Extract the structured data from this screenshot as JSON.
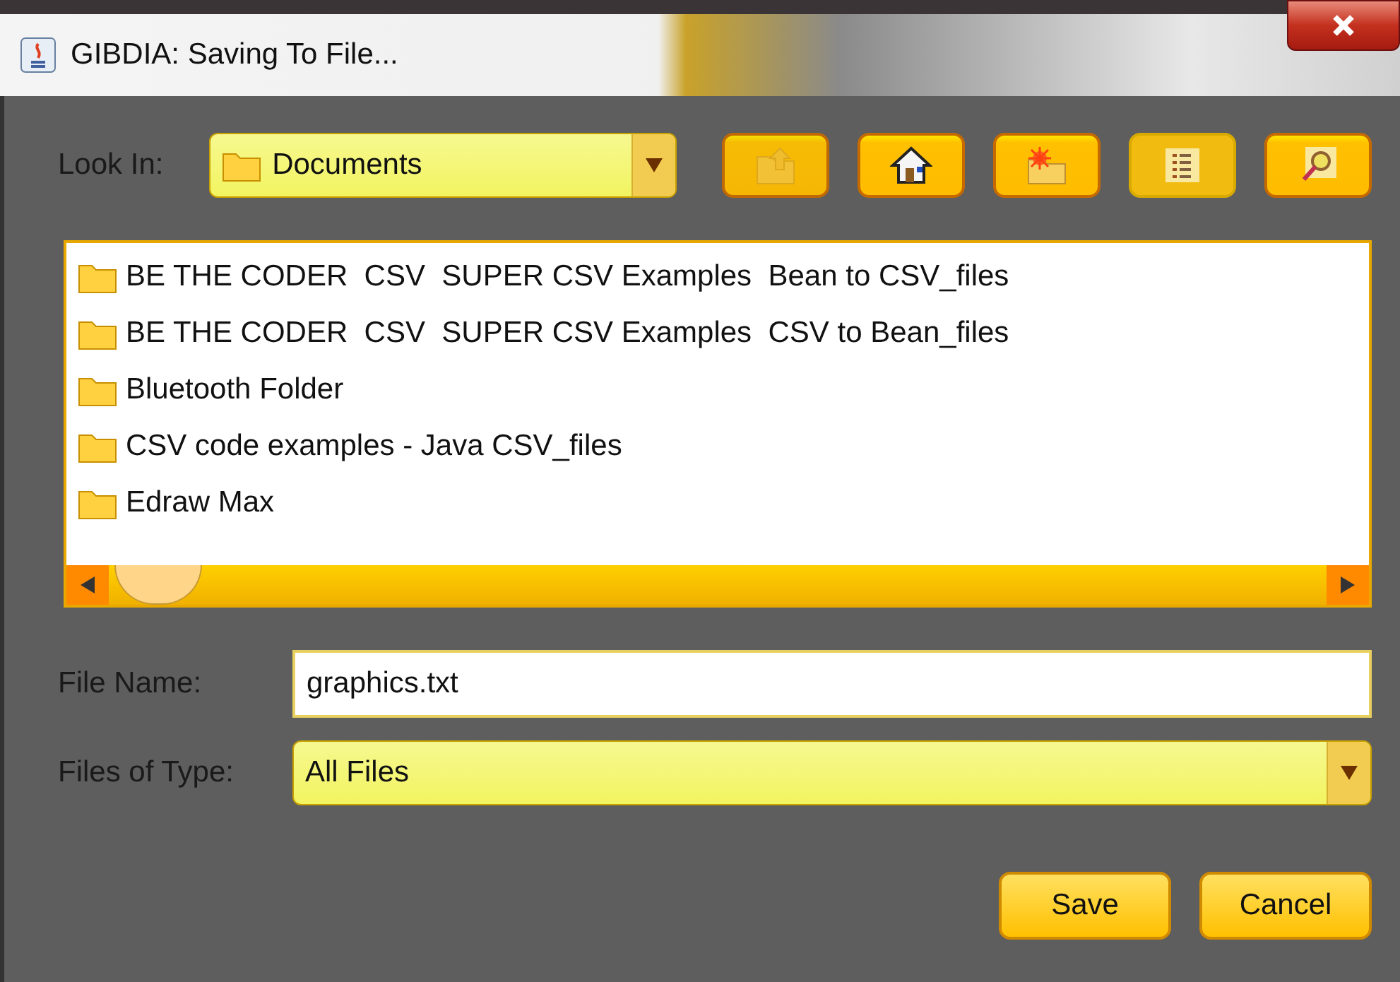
{
  "window": {
    "title": "GIBDIA: Saving To File..."
  },
  "look_in": {
    "label": "Look In:",
    "value": "Documents"
  },
  "toolbar": [
    {
      "kind": "up",
      "selected": false,
      "disabled": true
    },
    {
      "kind": "home",
      "selected": false,
      "disabled": false
    },
    {
      "kind": "new-folder",
      "selected": false,
      "disabled": false
    },
    {
      "kind": "list",
      "selected": true,
      "disabled": false
    },
    {
      "kind": "details",
      "selected": false,
      "disabled": false
    }
  ],
  "files": [
    {
      "name": "BE THE CODER  CSV  SUPER CSV Examples  Bean to CSV_files"
    },
    {
      "name": "BE THE CODER  CSV  SUPER CSV Examples  CSV to Bean_files"
    },
    {
      "name": "Bluetooth Folder"
    },
    {
      "name": "CSV code examples - Java CSV_files"
    },
    {
      "name": "Edraw Max"
    }
  ],
  "file_name": {
    "label": "File Name:",
    "value": "graphics.txt"
  },
  "file_type": {
    "label": "Files of Type:",
    "value": "All Files"
  },
  "buttons": [
    {
      "label": "Save"
    },
    {
      "label": "Cancel"
    }
  ]
}
